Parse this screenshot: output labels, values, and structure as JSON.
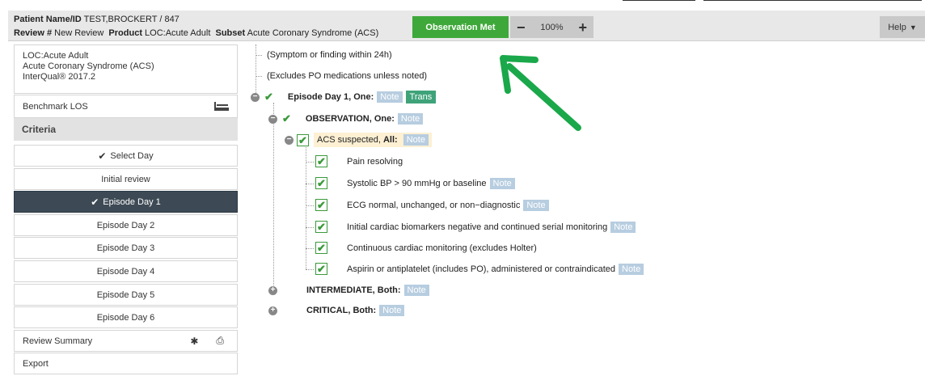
{
  "header": {
    "patient_label": "Patient Name/ID",
    "patient_value": "TEST,BROCKERT / 847",
    "review_label": "Review #",
    "review_value": "New Review",
    "product_label": "Product",
    "product_value": "LOC:Acute Adult",
    "subset_label": "Subset",
    "subset_value": "Acute Coronary Syndrome (ACS)",
    "observation_button": "Observation Met",
    "zoom_minus": "−",
    "zoom_value": "100%",
    "zoom_plus": "+",
    "help_label": "Help",
    "help_caret": "▼"
  },
  "sidebar": {
    "info_line1": "LOC:Acute Adult",
    "info_line2": "Acute Coronary Syndrome (ACS)",
    "info_line3": "InterQual® 2017.2",
    "benchmark": "Benchmark LOS",
    "criteria": "Criteria",
    "select_day": "Select Day",
    "initial_review": "Initial review",
    "days": [
      "Episode Day 1",
      "Episode Day 2",
      "Episode Day 3",
      "Episode Day 4",
      "Episode Day 5",
      "Episode Day 6"
    ],
    "review_summary": "Review Summary",
    "export": "Export"
  },
  "tree": {
    "line1": "(Symptom or finding within 24h)",
    "line2": "(Excludes PO medications unless noted)",
    "episode": "Episode Day 1, One:",
    "note": "Note",
    "trans": "Trans",
    "observation": "OBSERVATION, One:",
    "acs": "ACS suspected,",
    "acs_all": "All:",
    "items": [
      {
        "text": "Pain resolving",
        "note": false
      },
      {
        "text": "Systolic BP > 90 mmHg or baseline",
        "note": true
      },
      {
        "text": "ECG normal, unchanged, or non−diagnostic",
        "note": true
      },
      {
        "text": "Initial cardiac biomarkers negative and continued serial monitoring",
        "note": true
      },
      {
        "text": "Continuous cardiac monitoring (excludes Holter)",
        "note": false
      },
      {
        "text": "Aspirin or antiplatelet (includes PO), administered or contraindicated",
        "note": true
      }
    ],
    "intermediate": "INTERMEDIATE, Both:",
    "critical": "CRITICAL, Both:"
  },
  "colors": {
    "accent_green": "#3fa83a",
    "active_day": "#3d4a55",
    "note_bg": "#b7cde0",
    "arrow": "#1aa84a"
  }
}
